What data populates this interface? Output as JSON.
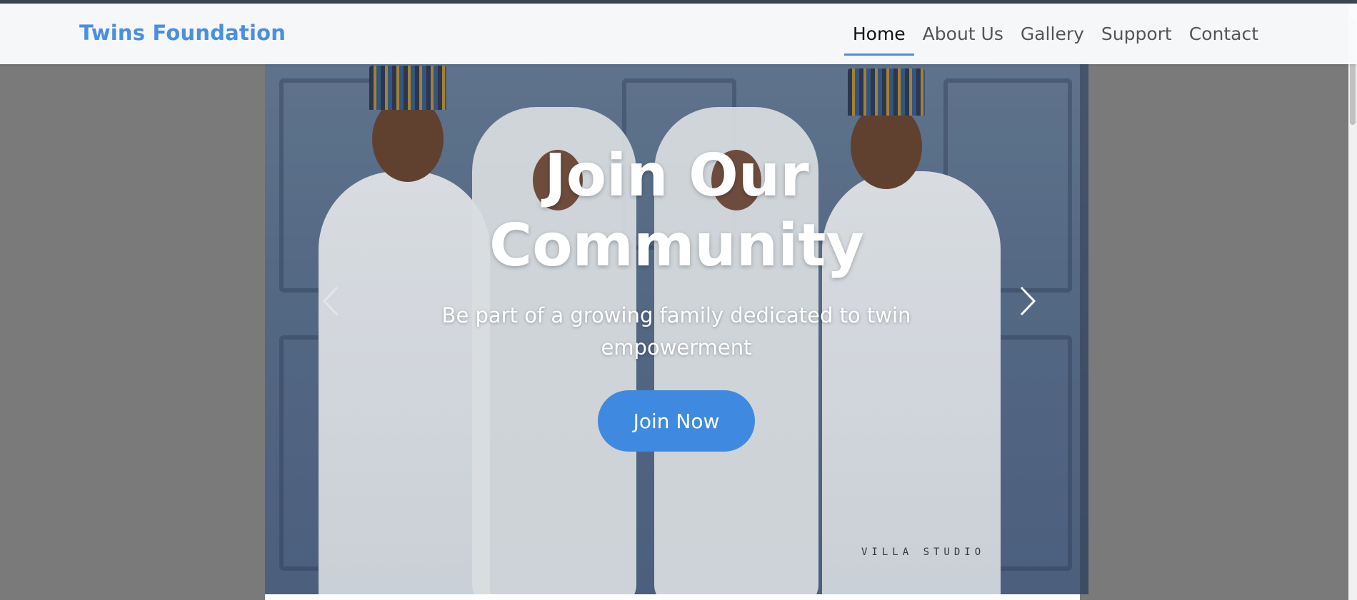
{
  "brand": {
    "name": "Twins Foundation"
  },
  "nav": {
    "items": [
      {
        "label": "Home",
        "active": true
      },
      {
        "label": "About Us",
        "active": false
      },
      {
        "label": "Gallery",
        "active": false
      },
      {
        "label": "Support",
        "active": false
      },
      {
        "label": "Contact",
        "active": false
      }
    ]
  },
  "hero": {
    "title_line1": "Join Our",
    "title_line2": "Community",
    "subtitle_line1": "Be part of a growing family dedicated to twin",
    "subtitle_line2": "empowerment",
    "cta_label": "Join Now",
    "watermark": "VILLA STUDIO",
    "prev_icon": "chevron-left-icon",
    "next_icon": "chevron-right-icon"
  },
  "colors": {
    "accent": "#4a8fe0",
    "button": "#3f8ae0",
    "backdrop": "#7a7a7a"
  }
}
